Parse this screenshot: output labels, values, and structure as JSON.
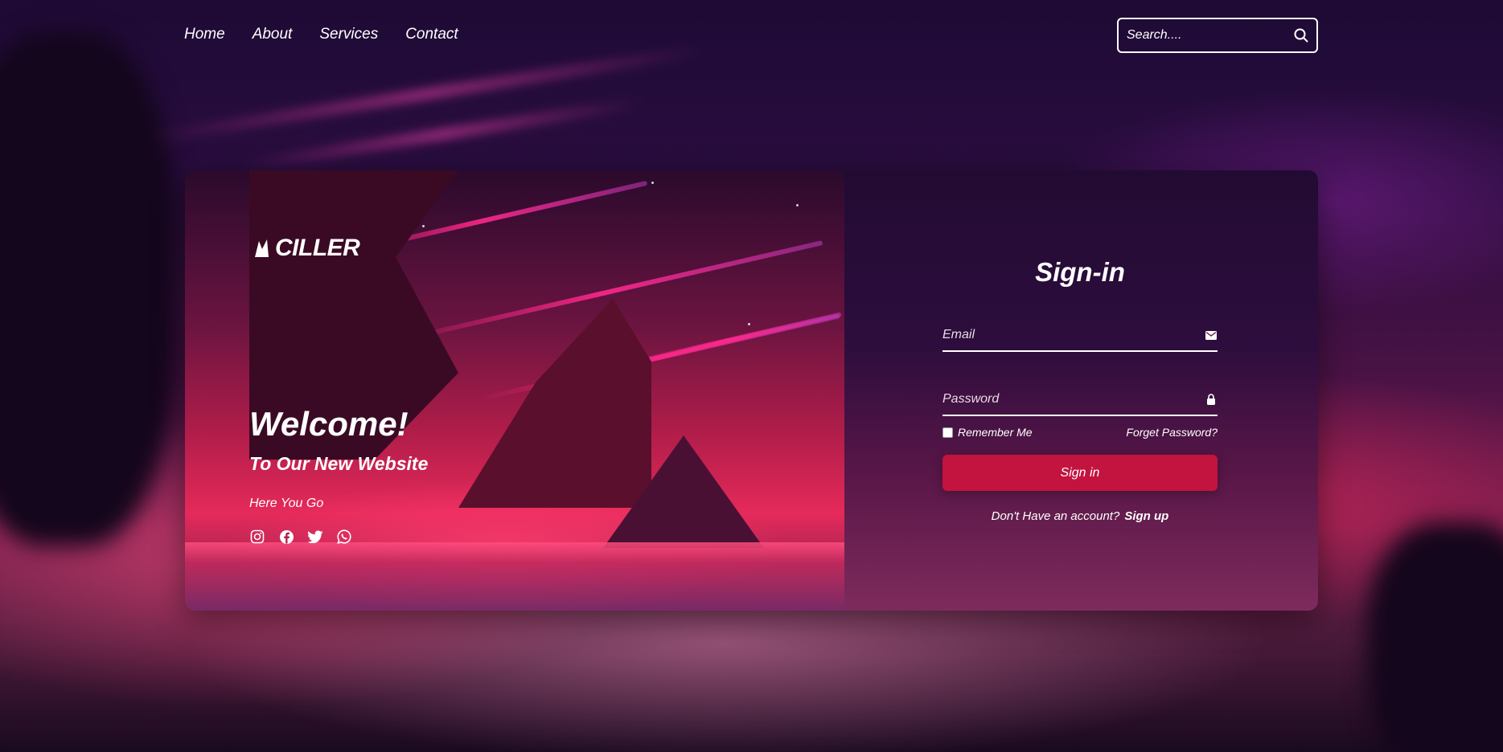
{
  "nav": {
    "items": [
      {
        "label": "Home"
      },
      {
        "label": "About"
      },
      {
        "label": "Services"
      },
      {
        "label": "Contact"
      }
    ]
  },
  "search": {
    "placeholder": "Search....",
    "icon": "search-icon"
  },
  "hero": {
    "logo_text": "CILLER",
    "welcome": "Welcome!",
    "subtitle": "To Our New Website",
    "tagline": "Here You Go",
    "socials": [
      "instagram-icon",
      "facebook-icon",
      "twitter-icon",
      "whatsapp-icon"
    ]
  },
  "signin": {
    "title": "Sign-in",
    "email_placeholder": "Email",
    "password_placeholder": "Password",
    "remember_label": "Remember Me",
    "forgot_label": "Forget Password?",
    "submit_label": "Sign in",
    "no_account_text": "Don't Have an account?",
    "signup_label": "Sign up"
  },
  "colors": {
    "accent": "#c3133f",
    "text": "#ffffff"
  }
}
